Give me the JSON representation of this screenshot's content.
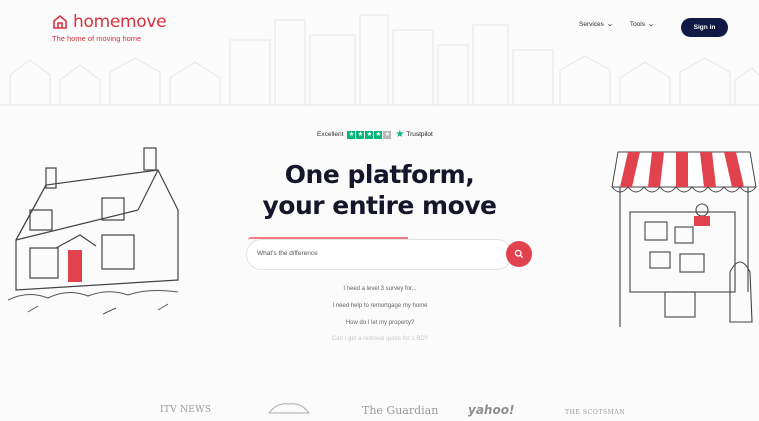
{
  "brand": {
    "name": "homemove",
    "tagline": "The home of moving home",
    "color": "#d9303e"
  },
  "nav": {
    "items": [
      {
        "label": "Services",
        "icon": "chevron-down-icon"
      },
      {
        "label": "Tools",
        "icon": "chevron-down-icon"
      }
    ],
    "signin": "Sign in",
    "signin_color": "#111a44"
  },
  "trust": {
    "label": "Excellent",
    "stars_filled": 4,
    "stars_total": 5,
    "provider": "Trustpilot",
    "star_color": "#00b67a"
  },
  "hero": {
    "line1": "One platform,",
    "line2": "your entire move"
  },
  "search": {
    "value": "What's the difference",
    "button_color": "#e2414e",
    "icon": "search-icon"
  },
  "suggestions": [
    "I need a level 3 survey for...",
    "I need help to remortgage my home",
    "How do I let my property?",
    "Can I get a removal quote for 1 BD?"
  ],
  "press": [
    "ITV NEWS",
    "",
    "The Guardian",
    "yahoo!",
    "THE SCOTSMAN"
  ]
}
